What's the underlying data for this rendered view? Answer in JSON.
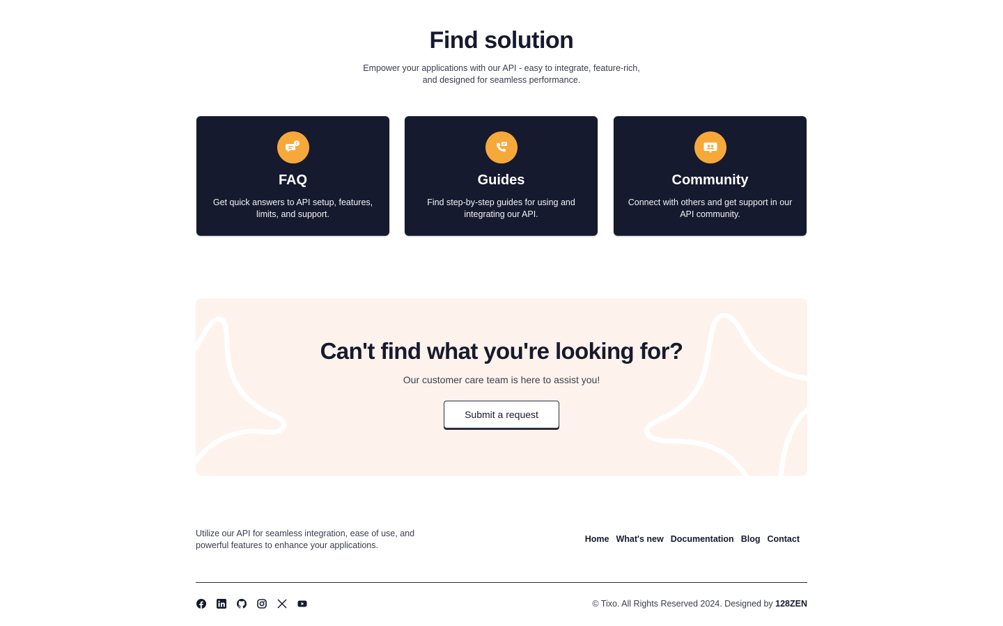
{
  "hero": {
    "title": "Find solution",
    "subtitle": "Empower your applications with our API - easy to integrate, feature-rich, and designed for seamless performance."
  },
  "cards": [
    {
      "icon": "faq-chat-icon",
      "title": "FAQ",
      "desc": "Get quick answers to API setup, features, limits, and support."
    },
    {
      "icon": "guides-phone-icon",
      "title": "Guides",
      "desc": "Find step-by-step guides for using and integrating our API."
    },
    {
      "icon": "community-chat-icon",
      "title": "Community",
      "desc": "Connect with others and get support in our API community."
    }
  ],
  "cta": {
    "title": "Can't find what you're looking for?",
    "subtitle": "Our customer care team is here to assist you!",
    "button": "Submit a request"
  },
  "footer": {
    "description": "Utilize our API for seamless integration, ease of use, and powerful features to enhance your applications.",
    "nav": [
      "Home",
      "What's new",
      "Documentation",
      "Blog",
      "Contact"
    ],
    "socials": [
      "facebook-icon",
      "linkedin-icon",
      "github-icon",
      "instagram-icon",
      "x-icon",
      "youtube-icon"
    ],
    "copyright_prefix": "© Tixo. All Rights Reserved 2024. Designed by ",
    "designer": "128ZEN"
  },
  "colors": {
    "dark": "#161a2e",
    "accent": "#f7a83a",
    "cta_bg": "#fdf3ec"
  }
}
